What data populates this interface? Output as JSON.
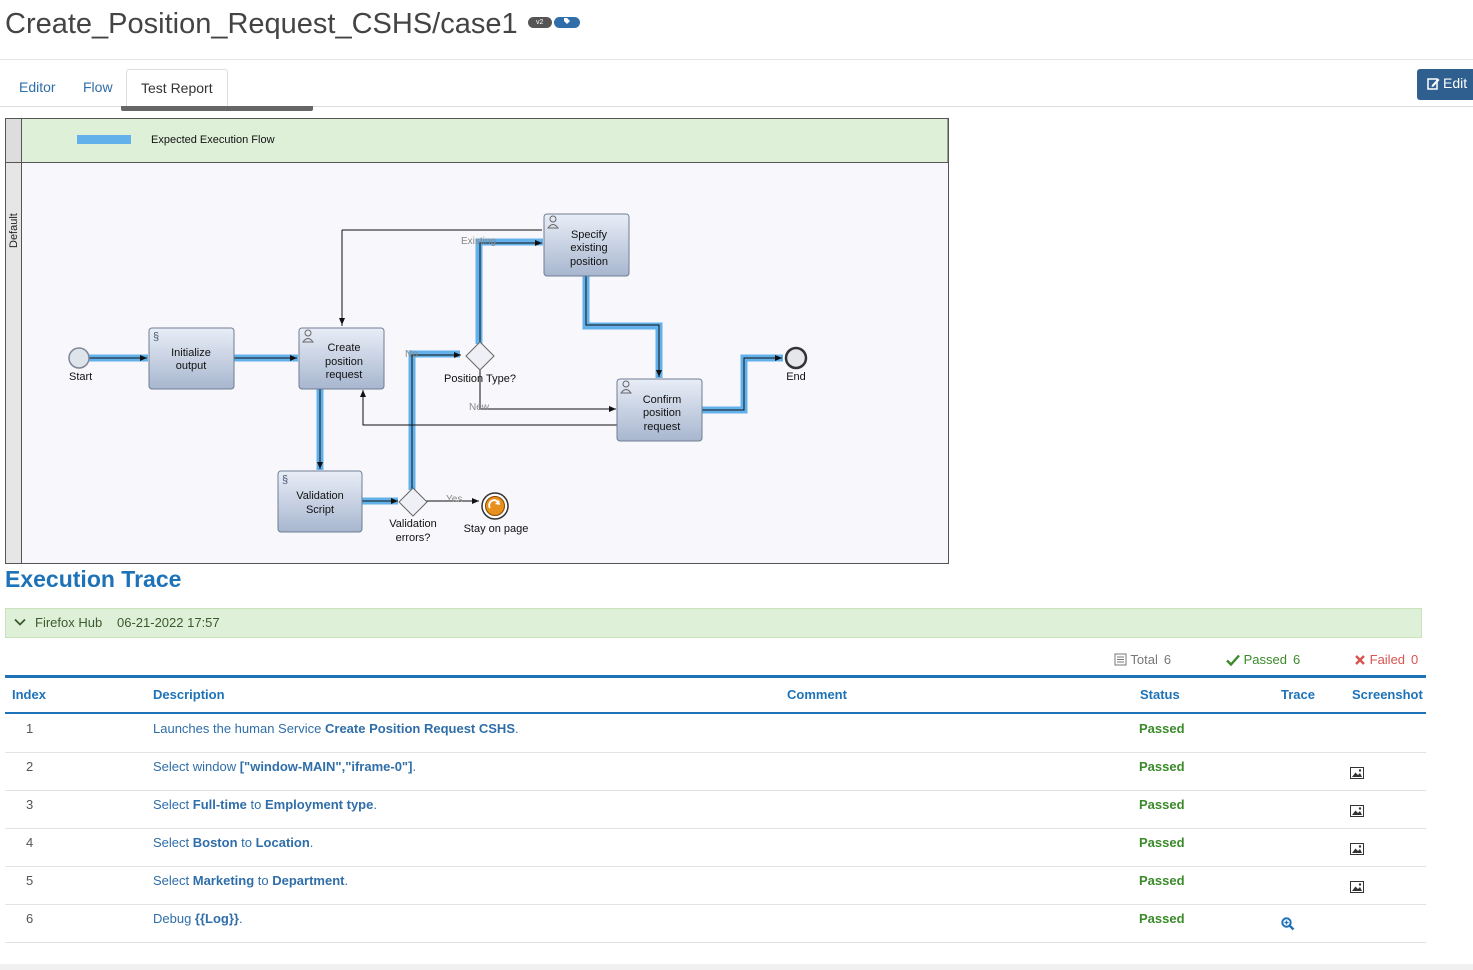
{
  "page": {
    "title": "Create_Position_Request_CSHS/case1",
    "badges": [
      "v2",
      "tag"
    ]
  },
  "tabs": [
    {
      "label": "Editor",
      "active": false
    },
    {
      "label": "Flow",
      "active": false
    },
    {
      "label": "Test Report",
      "active": true
    }
  ],
  "edit_button": {
    "label": "Edit",
    "icon": "edit-icon"
  },
  "diagram": {
    "legend_label": "Expected Execution Flow",
    "lane_label": "Default",
    "nodes": {
      "start": "Start",
      "init": [
        "Initialize",
        "output"
      ],
      "create": [
        "Create",
        "position",
        "request"
      ],
      "specify": [
        "Specify",
        "existing",
        "position"
      ],
      "confirm": [
        "Confirm",
        "position",
        "request"
      ],
      "validation": [
        "Validation",
        "Script"
      ],
      "end": "End",
      "stay": "Stay on page",
      "gw_position": "Position Type?",
      "gw_validation": [
        "Validation",
        "errors?"
      ]
    },
    "edge_labels": {
      "existing": "Existing",
      "new": "New",
      "no": "No",
      "yes": "Yes"
    },
    "colors": {
      "flow": "#63b1ea",
      "legend_bg": "#dff0d8"
    }
  },
  "execution": {
    "title": "Execution Trace",
    "run": {
      "hub": "Firefox Hub",
      "datetime": "06-21-2022 17:57"
    },
    "summary": {
      "total_label": "Total",
      "total": "6",
      "passed_label": "Passed",
      "passed": "6",
      "failed_label": "Failed",
      "failed": "0"
    },
    "columns": {
      "index": "Index",
      "description": "Description",
      "comment": "Comment",
      "status": "Status",
      "trace": "Trace",
      "screenshot": "Screenshot"
    },
    "rows": [
      {
        "index": "1",
        "desc_pre": "Launches the human Service ",
        "desc_bold": "Create Position Request CSHS",
        "desc_mid": "",
        "desc_bold2": "",
        "desc_post": ".",
        "status": "Passed",
        "screenshot": false,
        "trace": false
      },
      {
        "index": "2",
        "desc_pre": "Select window ",
        "desc_bold": "[\"window-MAIN\",\"iframe-0\"]",
        "desc_mid": "",
        "desc_bold2": "",
        "desc_post": ".",
        "status": "Passed",
        "screenshot": true,
        "trace": false
      },
      {
        "index": "3",
        "desc_pre": "Select ",
        "desc_bold": "Full-time",
        "desc_mid": " to ",
        "desc_bold2": "Employment type",
        "desc_post": ".",
        "status": "Passed",
        "screenshot": true,
        "trace": false
      },
      {
        "index": "4",
        "desc_pre": "Select ",
        "desc_bold": "Boston",
        "desc_mid": " to ",
        "desc_bold2": "Location",
        "desc_post": ".",
        "status": "Passed",
        "screenshot": true,
        "trace": false
      },
      {
        "index": "5",
        "desc_pre": "Select ",
        "desc_bold": "Marketing",
        "desc_mid": " to ",
        "desc_bold2": "Department",
        "desc_post": ".",
        "status": "Passed",
        "screenshot": true,
        "trace": false
      },
      {
        "index": "6",
        "desc_pre": "Debug ",
        "desc_bold": "{{Log}}",
        "desc_mid": "",
        "desc_bold2": "",
        "desc_post": ".",
        "status": "Passed",
        "screenshot": false,
        "trace": true
      }
    ]
  }
}
